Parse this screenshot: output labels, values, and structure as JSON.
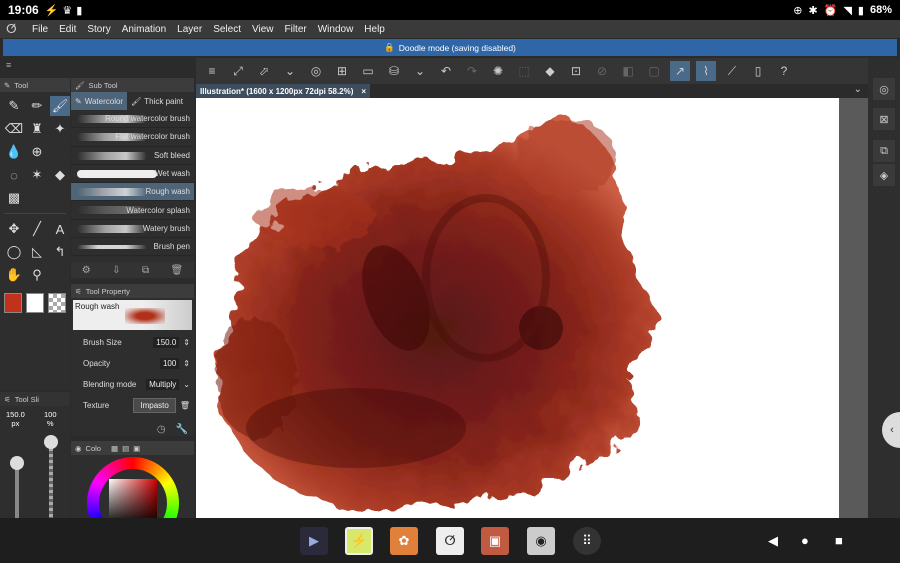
{
  "status_bar": {
    "time": "19:06",
    "left_icons": [
      "lightning-icon",
      "crown-icon",
      "flashlight-icon"
    ],
    "battery": "68%"
  },
  "menu": {
    "items": [
      "File",
      "Edit",
      "Story",
      "Animation",
      "Layer",
      "Select",
      "View",
      "Filter",
      "Window",
      "Help"
    ]
  },
  "banner": {
    "text": "Doodle mode (saving disabled)"
  },
  "tool_panel": {
    "title": "Tool"
  },
  "sub_tool": {
    "title": "Sub Tool",
    "tabs": [
      "Watercolor",
      "Thick paint"
    ],
    "brushes": [
      "Round watercolor brush",
      "Flat watercolor brush",
      "Soft bleed",
      "Wet wash",
      "Rough wash",
      "Watercolor splash",
      "Watery brush",
      "Brush pen"
    ],
    "selected": "Rough wash"
  },
  "tool_property": {
    "title": "Tool Property",
    "preview_label": "Rough wash",
    "brush_size_label": "Brush Size",
    "brush_size_value": "150.0",
    "opacity_label": "Opacity",
    "opacity_value": "100",
    "blending_label": "Blending mode",
    "blending_value": "Multiply",
    "texture_label": "Texture",
    "texture_value": "Impasto"
  },
  "tool_slider": {
    "title": "Tool Sli",
    "size_value": "150.0",
    "size_unit": "px",
    "opacity_value": "100",
    "opacity_unit": "%"
  },
  "color_panel": {
    "title": "Colo"
  },
  "document": {
    "tab_label": "Illustration* (1600 x 1200px 72dpi 58.2%)"
  },
  "colors": {
    "main_color": "#c0321a",
    "sub_color": "#ffffff",
    "banner": "#2f66a8",
    "paint": "#8b1a0c"
  }
}
